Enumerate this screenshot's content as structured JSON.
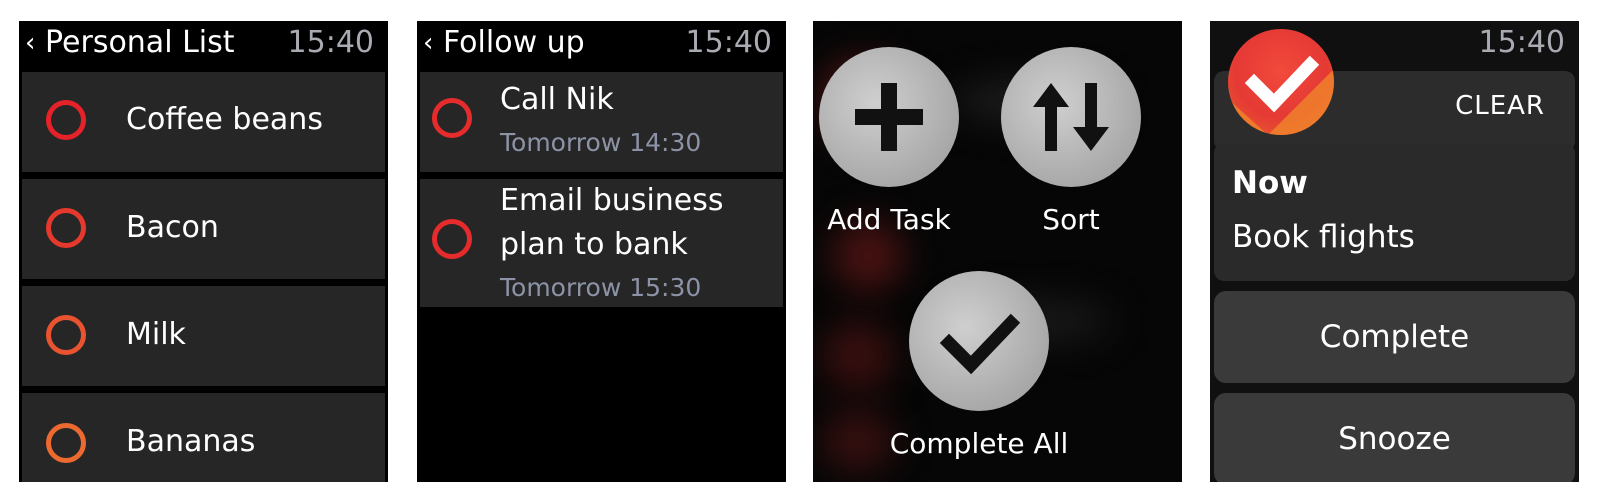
{
  "screens": {
    "personal_list": {
      "title": "Personal List",
      "back_glyph": "‹",
      "time": "15:40",
      "items": [
        {
          "label": "Coffee beans",
          "circle_color": "#e5222a"
        },
        {
          "label": "Bacon",
          "circle_color": "#e6392e"
        },
        {
          "label": "Milk",
          "circle_color": "#e9532f"
        },
        {
          "label": "Bananas",
          "circle_color": "#ec6a30"
        }
      ]
    },
    "follow_up": {
      "title": "Follow up",
      "back_glyph": "‹",
      "time": "15:40",
      "items": [
        {
          "label": "Call Nik",
          "due": "Tomorrow 14:30"
        },
        {
          "label_line1": "Email business",
          "label_line2": "plan to bank",
          "due": "Tomorrow 15:30"
        }
      ]
    },
    "actions": {
      "add_task": {
        "label": "Add Task",
        "icon": "plus-icon"
      },
      "sort": {
        "label": "Sort",
        "icon": "sort-arrows-icon"
      },
      "complete_all": {
        "label": "Complete All",
        "icon": "checkmark-icon"
      }
    },
    "notification": {
      "time": "15:40",
      "clear_label": "CLEAR",
      "heading": "Now",
      "body": "Book flights",
      "complete_label": "Complete",
      "snooze_label": "Snooze",
      "app_icon": "app-checkmark-icon"
    }
  },
  "colors": {
    "accent_red": "#e5222a",
    "subtext": "#8d93a6",
    "time_gray": "#a9abb2",
    "row_bg": "#262626"
  }
}
